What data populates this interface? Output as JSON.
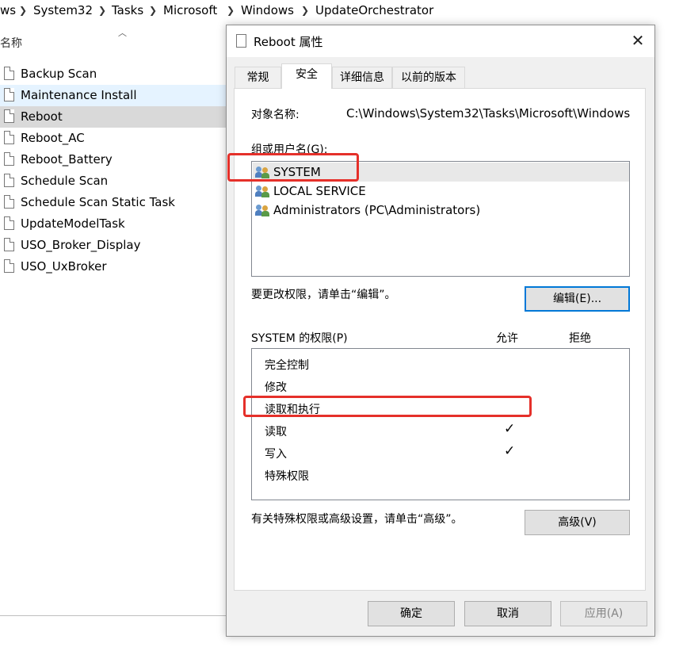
{
  "breadcrumb": [
    "ws",
    "System32",
    "Tasks",
    "Microsoft",
    "Windows",
    "UpdateOrchestrator"
  ],
  "explorer": {
    "column_header": "名称",
    "files": [
      "Backup Scan",
      "Maintenance Install",
      "Reboot",
      "Reboot_AC",
      "Reboot_Battery",
      "Schedule Scan",
      "Schedule Scan Static Task",
      "UpdateModelTask",
      "USO_Broker_Display",
      "USO_UxBroker"
    ]
  },
  "dialog": {
    "title": "Reboot 属性",
    "tabs": [
      "常规",
      "安全",
      "详细信息",
      "以前的版本"
    ],
    "object_label": "对象名称:",
    "object_value": "C:\\Windows\\System32\\Tasks\\Microsoft\\Windows",
    "group_label": "组或用户名(G):",
    "users": [
      "SYSTEM",
      "LOCAL SERVICE",
      "Administrators (PC\\Administrators)"
    ],
    "edit_hint": "要更改权限，请单击“编辑”。",
    "edit_button": "编辑(E)...",
    "perm_label": "SYSTEM 的权限(P)",
    "allow_header": "允许",
    "deny_header": "拒绝",
    "permissions": [
      {
        "name": "完全控制",
        "allow": false,
        "deny": false
      },
      {
        "name": "修改",
        "allow": false,
        "deny": false
      },
      {
        "name": "读取和执行",
        "allow": false,
        "deny": false
      },
      {
        "name": "读取",
        "allow": true,
        "deny": false
      },
      {
        "name": "写入",
        "allow": true,
        "deny": false
      },
      {
        "name": "特殊权限",
        "allow": false,
        "deny": false
      }
    ],
    "advanced_hint": "有关特殊权限或高级设置，请单击“高级”。",
    "advanced_button": "高级(V)",
    "ok_button": "确定",
    "cancel_button": "取消",
    "apply_button": "应用(A)",
    "check_glyph": "✓",
    "close_glyph": "✕"
  },
  "colors": {
    "highlight": "#e5302a",
    "selection": "#d9d9d9",
    "hover": "#e5f3ff",
    "focus_border": "#0078d7"
  },
  "icons": {
    "file": "document-icon",
    "user": "user-group-icon",
    "close": "close-icon",
    "check": "check-icon",
    "breadcrumb_separator": "chevron-right-icon",
    "sort": "sort-up-icon"
  }
}
